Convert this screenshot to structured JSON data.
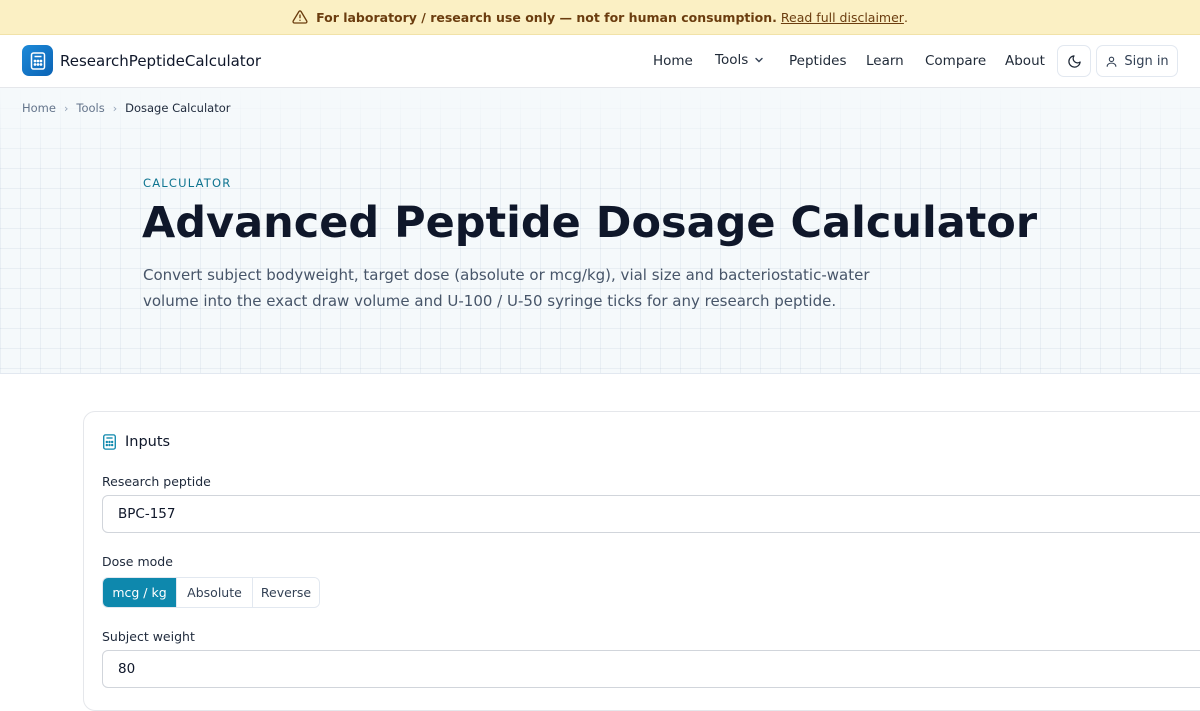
{
  "banner": {
    "message": "For laboratory / research use only — not for human consumption.",
    "link": "Read full disclaimer",
    "trailing": "."
  },
  "header": {
    "brand": "ResearchPeptideCalculator",
    "nav": [
      "Home",
      "Tools",
      "Peptides",
      "Learn",
      "Compare",
      "About"
    ],
    "sign_in": "Sign in"
  },
  "breadcrumb": [
    "Home",
    "Tools",
    "Dosage Calculator"
  ],
  "hero": {
    "eyebrow": "CALCULATOR",
    "title": "Advanced Peptide Dosage Calculator",
    "subtitle": "Convert subject bodyweight, target dose (absolute or mcg/kg), vial size and bacteriostatic-water volume into the exact draw volume and U-100 / U-50 syringe ticks for any research peptide."
  },
  "inputs": {
    "heading": "Inputs",
    "peptide_label": "Research peptide",
    "peptide_value": "BPC-157",
    "dose_mode_label": "Dose mode",
    "dose_modes": [
      "mcg / kg",
      "Absolute",
      "Reverse"
    ],
    "dose_mode_selected": "mcg / kg",
    "weight_label": "Subject weight",
    "weight_value": "80"
  },
  "colors": {
    "banner_bg": "#fbf0c4",
    "accent": "#0e88ad",
    "logo": "#1d8ad8"
  }
}
